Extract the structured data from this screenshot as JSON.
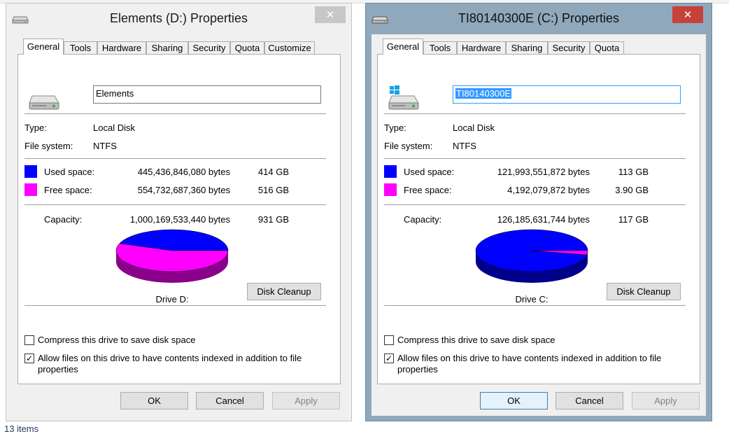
{
  "status_bar": {
    "items_count": "13 items"
  },
  "dialogs": [
    {
      "title": "Elements (D:) Properties",
      "tabs": [
        "General",
        "Tools",
        "Hardware",
        "Sharing",
        "Security",
        "Quota",
        "Customize"
      ],
      "active_tab": "General",
      "name_value": "Elements",
      "type_label": "Type:",
      "type_value": "Local Disk",
      "fs_label": "File system:",
      "fs_value": "NTFS",
      "used_label": "Used space:",
      "used_bytes": "445,436,846,080 bytes",
      "used_size": "414 GB",
      "free_label": "Free space:",
      "free_bytes": "554,732,687,360 bytes",
      "free_size": "516 GB",
      "capacity_label": "Capacity:",
      "capacity_bytes": "1,000,169,533,440 bytes",
      "capacity_size": "931 GB",
      "used_fraction": 0.445,
      "drive_label": "Drive D:",
      "disk_cleanup": "Disk Cleanup",
      "compress_label": "Compress this drive to save disk space",
      "compress_checked": false,
      "index_label_line1": "Allow files on this drive to have contents indexed in addition to file",
      "index_label_line2": "properties",
      "index_checked": true,
      "ok": "OK",
      "cancel": "Cancel",
      "apply": "Apply"
    },
    {
      "title": "TI80140300E (C:) Properties",
      "tabs": [
        "General",
        "Tools",
        "Hardware",
        "Sharing",
        "Security",
        "Quota"
      ],
      "active_tab": "General",
      "name_value": "TI80140300E",
      "type_label": "Type:",
      "type_value": "Local Disk",
      "fs_label": "File system:",
      "fs_value": "NTFS",
      "used_label": "Used space:",
      "used_bytes": "121,993,551,872 bytes",
      "used_size": "113 GB",
      "free_label": "Free space:",
      "free_bytes": "4,192,079,872 bytes",
      "free_size": "3.90 GB",
      "capacity_label": "Capacity:",
      "capacity_bytes": "126,185,631,744 bytes",
      "capacity_size": "117 GB",
      "used_fraction": 0.967,
      "drive_label": "Drive C:",
      "disk_cleanup": "Disk Cleanup",
      "compress_label": "Compress this drive to save disk space",
      "compress_checked": false,
      "index_label_line1": "Allow files on this drive to have contents indexed in addition to file",
      "index_label_line2": "properties",
      "index_checked": true,
      "ok": "OK",
      "cancel": "Cancel",
      "apply": "Apply"
    }
  ],
  "colors": {
    "used": "#0000ff",
    "used_dark": "#00008b",
    "free": "#ff00ff",
    "free_dark": "#8b008b",
    "close_active": "#c7413a"
  },
  "icons": {
    "drive": "hard-drive-icon",
    "windows_drive": "windows-drive-icon",
    "close": "close-icon",
    "check": "checkmark-icon"
  }
}
